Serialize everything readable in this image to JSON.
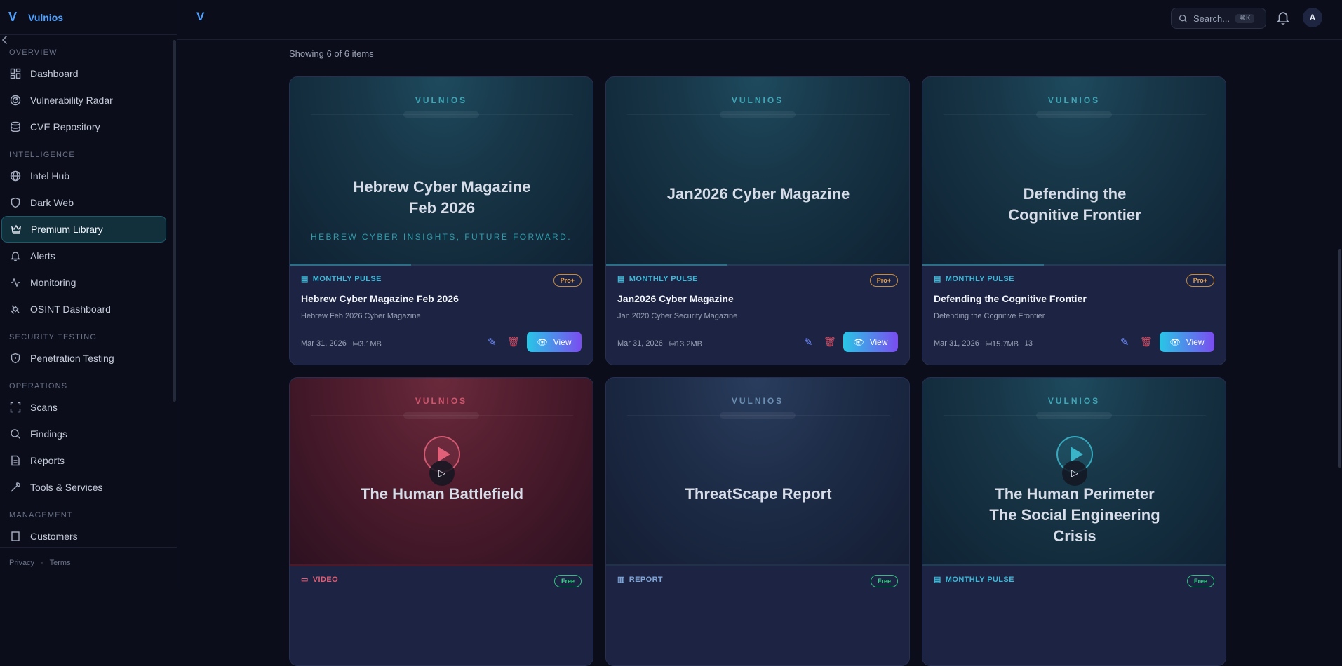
{
  "brand": {
    "logo": "V",
    "name": "Vulnios"
  },
  "sidebar": {
    "sections": [
      {
        "title": "OVERVIEW",
        "items": [
          {
            "label": "Dashboard",
            "icon": "dashboard-icon"
          },
          {
            "label": "Vulnerability Radar",
            "icon": "radar-icon"
          },
          {
            "label": "CVE Repository",
            "icon": "database-icon"
          }
        ]
      },
      {
        "title": "INTELLIGENCE",
        "items": [
          {
            "label": "Intel Hub",
            "icon": "globe-icon"
          },
          {
            "label": "Dark Web",
            "icon": "shield-icon"
          },
          {
            "label": "Premium Library",
            "icon": "crown-icon",
            "active": true
          },
          {
            "label": "Alerts",
            "icon": "bell-icon"
          },
          {
            "label": "Monitoring",
            "icon": "activity-icon"
          },
          {
            "label": "OSINT Dashboard",
            "icon": "satellite-icon"
          }
        ]
      },
      {
        "title": "SECURITY TESTING",
        "items": [
          {
            "label": "Penetration Testing",
            "icon": "shield-icon"
          }
        ]
      },
      {
        "title": "OPERATIONS",
        "items": [
          {
            "label": "Scans",
            "icon": "scan-icon"
          },
          {
            "label": "Findings",
            "icon": "search-icon"
          },
          {
            "label": "Reports",
            "icon": "file-icon"
          },
          {
            "label": "Tools & Services",
            "icon": "wrench-icon"
          }
        ]
      },
      {
        "title": "MANAGEMENT",
        "items": [
          {
            "label": "Customers",
            "icon": "building-icon"
          }
        ]
      }
    ],
    "footer": {
      "privacy": "Privacy",
      "dot": "·",
      "terms": "Terms"
    }
  },
  "topbar": {
    "mark": "V",
    "search_placeholder": "Search...",
    "search_shortcut": "⌘K",
    "avatar_initial": "A"
  },
  "main": {
    "showing": "Showing 6 of 6 items",
    "cards": [
      {
        "cover_brand": "VULNIOS",
        "cover_title_lines": [
          "Hebrew Cyber Magazine",
          "Feb 2026"
        ],
        "cover_tagline": "HEBREW CYBER INSIGHTS, FUTURE FORWARD.",
        "theme": "teal",
        "category": "MONTHLY PULSE",
        "badge": "Pro+",
        "title": "Hebrew Cyber Magazine Feb 2026",
        "subtitle": "Hebrew Feb 2026 Cyber Magazine",
        "date": "Mar 31, 2026",
        "size": "3.1MB",
        "downloads": "",
        "view_label": "View"
      },
      {
        "cover_brand": "VULNIOS",
        "cover_title_lines": [
          "Jan2026 Cyber Magazine"
        ],
        "cover_tagline": "",
        "theme": "teal",
        "category": "MONTHLY PULSE",
        "badge": "Pro+",
        "title": "Jan2026 Cyber Magazine",
        "subtitle": "Jan 2020 Cyber Security Magazine",
        "date": "Mar 31, 2026",
        "size": "13.2MB",
        "downloads": "",
        "view_label": "View"
      },
      {
        "cover_brand": "VULNIOS",
        "cover_title_lines": [
          "Defending the",
          "Cognitive Frontier"
        ],
        "cover_tagline": "",
        "theme": "teal",
        "category": "MONTHLY PULSE",
        "badge": "Pro+",
        "title": "Defending the Cognitive Frontier",
        "subtitle": "Defending the Cognitive Frontier",
        "date": "Mar 31, 2026",
        "size": "15.7MB",
        "downloads": "3",
        "view_label": "View"
      },
      {
        "cover_brand": "VULNIOS",
        "cover_title_lines": [
          "The Human Battlefield"
        ],
        "theme": "red",
        "category": "VIDEO",
        "badge": "Free"
      },
      {
        "cover_brand": "VULNIOS",
        "cover_title_lines": [
          "ThreatScape Report"
        ],
        "theme": "navy",
        "category": "REPORT",
        "badge": "Free"
      },
      {
        "cover_brand": "VULNIOS",
        "cover_title_lines": [
          "The Human Perimeter",
          "The Social Engineering",
          "Crisis"
        ],
        "theme": "teal",
        "category": "MONTHLY PULSE",
        "badge": "Free"
      }
    ]
  }
}
